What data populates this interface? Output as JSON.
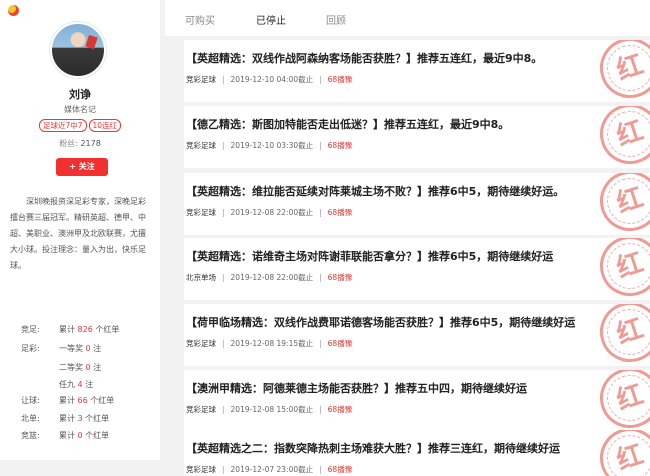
{
  "app": {
    "logo_icon": "colorful-circle-logo-icon"
  },
  "profile": {
    "name": "刘诤",
    "title": "媒体名记",
    "tags": [
      "足球近7中7",
      "10连红"
    ],
    "fans_label": "粉丝:",
    "fans_count": "2178",
    "follow_label": "+ 关注",
    "bio": "深圳晚报资深足彩专家，深晚足彩擂台赛三届冠军。精研英超、德甲、中超、美职业、澳洲甲及北欧联赛，尤擅大小球。投注理念：量入为出，快乐足球。"
  },
  "stats": [
    {
      "label": "竞足:",
      "prefix": "累计 ",
      "count": "826",
      "suffix": " 个红单"
    },
    {
      "label": "足彩:",
      "prefix": "一等奖 ",
      "count": "0",
      "suffix": " 注"
    },
    {
      "label": "",
      "prefix": "二等奖 ",
      "count": "0",
      "suffix": " 注"
    },
    {
      "label": "",
      "prefix": "任九 ",
      "count": "4",
      "suffix": " 注"
    },
    {
      "label": "让球:",
      "prefix": "累计 ",
      "count": "66",
      "suffix": " 个红单"
    },
    {
      "label": "北单:",
      "prefix": "累计 ",
      "count": "3",
      "suffix": " 个红单"
    },
    {
      "label": "竞篮:",
      "prefix": "累计 ",
      "count": "0",
      "suffix": " 个红单"
    }
  ],
  "tabs": [
    {
      "label": "可购买",
      "active": false
    },
    {
      "label": "已停止",
      "active": true
    },
    {
      "label": "回顾",
      "active": false
    }
  ],
  "articles": [
    {
      "title": "【英超精选：双线作战阿森纳客场能否获胜？】推荐五连红，最近9中8。",
      "league": "竞彩足球",
      "time": "2019-12-10 04:00截止",
      "views": "68播豫",
      "stamp": "红"
    },
    {
      "title": "【德乙精选：斯图加特能否走出低迷？】推荐五连红，最近9中8。",
      "league": "竞彩足球",
      "time": "2019-12-10 03:30截止",
      "views": "68播豫",
      "stamp": "红"
    },
    {
      "title": "【英超精选：维拉能否延续对阵莱城主场不败？】推荐6中5，期待继续好运。",
      "league": "竞彩足球",
      "time": "2019-12-08 22:00截止",
      "views": "68播豫",
      "stamp": "红"
    },
    {
      "title": "【英超精选：诺维奇主场对阵谢菲联能否拿分？】推荐6中5，期待继续好运",
      "league": "北京单场",
      "time": "2019-12-08 22:00截止",
      "views": "68播豫",
      "stamp": "红"
    },
    {
      "title": "【荷甲临场精选：双线作战费耶诺德客场能否获胜？】推荐6中5，期待继续好运",
      "league": "竞彩足球",
      "time": "2019-12-08 19:15截止",
      "views": "68播豫",
      "stamp": "红"
    },
    {
      "title": "【澳洲甲精选：阿德莱德主场能否获胜？】推荐五中四，期待继续好运",
      "league": "竞彩足球",
      "time": "2019-12-08 15:00截止",
      "views": "68播豫",
      "stamp": "红"
    },
    {
      "title": "【英超精选之二：指数突降热刺主场难获大胜？】推荐三连红，期待继续好运",
      "league": "竞彩足球",
      "time": "2019-12-07 23:00截止",
      "views": "68播豫",
      "stamp": "红"
    }
  ]
}
